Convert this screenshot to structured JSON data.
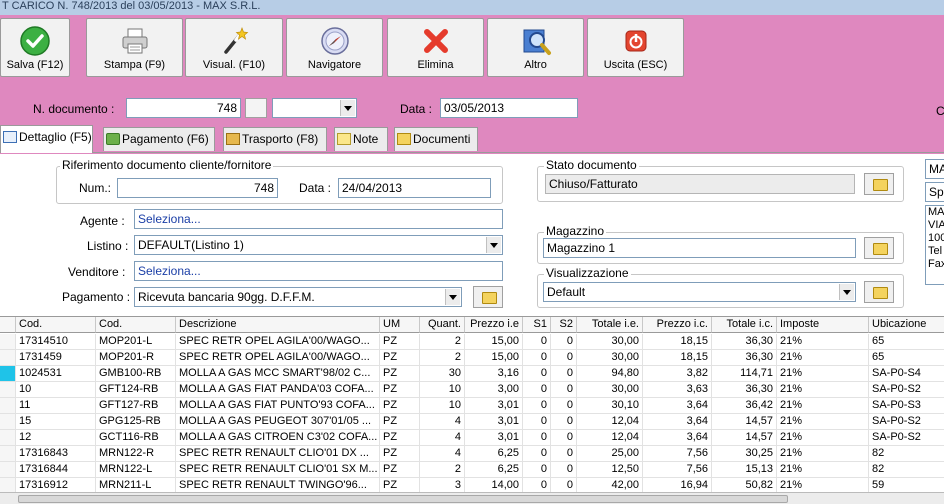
{
  "window": {
    "title": "T CARICO N. 748/2013 del 03/05/2013 - MAX S.R.L."
  },
  "toolbar": {
    "buttons": [
      {
        "label": "Salva (F12)",
        "icon": "check-icon"
      },
      {
        "label": "Stampa (F9)",
        "icon": "printer-icon"
      },
      {
        "label": "Visual. (F10)",
        "icon": "magic-wand-icon"
      },
      {
        "label": "Navigatore",
        "icon": "compass-icon"
      },
      {
        "label": "Elimina",
        "icon": "delete-x-icon"
      },
      {
        "label": "Altro",
        "icon": "magnifier-icon"
      },
      {
        "label": "Uscita (ESC)",
        "icon": "exit-icon"
      }
    ]
  },
  "header": {
    "n_documento_label": "N. documento :",
    "n_documento_value": "748",
    "data_label": "Data :",
    "data_value": "03/05/2013",
    "right_edge_text": "C"
  },
  "tabs": [
    {
      "label": "Dettaglio (F5)"
    },
    {
      "label": "Pagamento (F6)"
    },
    {
      "label": "Trasporto (F8)"
    },
    {
      "label": "Note"
    },
    {
      "label": "Documenti"
    }
  ],
  "riferimento": {
    "title": "Riferimento documento cliente/fornitore",
    "num_label": "Num.:",
    "num_value": "748",
    "data_label": "Data :",
    "data_value": "24/04/2013"
  },
  "form": {
    "agente_label": "Agente :",
    "agente_value": "Seleziona...",
    "listino_label": "Listino :",
    "listino_value": "DEFAULT(Listino 1)",
    "venditore_label": "Venditore :",
    "venditore_value": "Seleziona...",
    "pagamento_label": "Pagamento :",
    "pagamento_value": "Ricevuta bancaria 90gg. D.F.F.M."
  },
  "stato": {
    "title": "Stato documento",
    "value": "Chiuso/Fatturato"
  },
  "magazzino": {
    "title": "Magazzino",
    "value": "Magazzino 1"
  },
  "visualizzazione": {
    "title": "Visualizzazione",
    "value": "Default"
  },
  "right_panel": {
    "field1": "MA",
    "field2": "Spe",
    "address_lines": [
      "MA",
      "VIA",
      "100",
      "Tel",
      "Fax"
    ]
  },
  "table": {
    "columns": [
      "Cod.",
      "Cod.",
      "Descrizione",
      "UM",
      "Quant.",
      "Prezzo i.e",
      "S1",
      "S2",
      "Totale i.e.",
      "Prezzo i.c.",
      "Totale i.c.",
      "Imposte",
      "Ubicazione"
    ],
    "rows": [
      [
        "17314510",
        "MOP201-L",
        "SPEC RETR OPEL AGILA'00/WAGO...",
        "PZ",
        "2",
        "15,00",
        "0",
        "0",
        "30,00",
        "18,15",
        "36,30",
        "21%",
        "65"
      ],
      [
        "1731459",
        "MOP201-R",
        "SPEC RETR OPEL AGILA'00/WAGO...",
        "PZ",
        "2",
        "15,00",
        "0",
        "0",
        "30,00",
        "18,15",
        "36,30",
        "21%",
        "65"
      ],
      [
        "1024531",
        "GMB100-RB",
        "MOLLA A GAS MCC SMART'98/02 C...",
        "PZ",
        "30",
        "3,16",
        "0",
        "0",
        "94,80",
        "3,82",
        "114,71",
        "21%",
        "SA-P0-S4"
      ],
      [
        "10",
        "GFT124-RB",
        "MOLLA A GAS FIAT PANDA'03 COFA...",
        "PZ",
        "10",
        "3,00",
        "0",
        "0",
        "30,00",
        "3,63",
        "36,30",
        "21%",
        "SA-P0-S2"
      ],
      [
        "11",
        "GFT127-RB",
        "MOLLA A GAS FIAT PUNTO'93 COFA...",
        "PZ",
        "10",
        "3,01",
        "0",
        "0",
        "30,10",
        "3,64",
        "36,42",
        "21%",
        "SA-P0-S3"
      ],
      [
        "15",
        "GPG125-RB",
        "MOLLA A GAS PEUGEOT 307'01/05 ...",
        "PZ",
        "4",
        "3,01",
        "0",
        "0",
        "12,04",
        "3,64",
        "14,57",
        "21%",
        "SA-P0-S2"
      ],
      [
        "12",
        "GCT116-RB",
        "MOLLA A GAS CITROEN C3'02 COFA...",
        "PZ",
        "4",
        "3,01",
        "0",
        "0",
        "12,04",
        "3,64",
        "14,57",
        "21%",
        "SA-P0-S2"
      ],
      [
        "17316843",
        "MRN122-R",
        "SPEC RETR RENAULT CLIO'01 DX ...",
        "PZ",
        "4",
        "6,25",
        "0",
        "0",
        "25,00",
        "7,56",
        "30,25",
        "21%",
        "82"
      ],
      [
        "17316844",
        "MRN122-L",
        "SPEC RETR RENAULT CLIO'01 SX M...",
        "PZ",
        "2",
        "6,25",
        "0",
        "0",
        "12,50",
        "7,56",
        "15,13",
        "21%",
        "82"
      ],
      [
        "17316912",
        "MRN211-L",
        "SPEC RETR RENAULT TWINGO'96...",
        "PZ",
        "3",
        "14,00",
        "0",
        "0",
        "42,00",
        "16,94",
        "50,82",
        "21%",
        "59"
      ]
    ]
  }
}
